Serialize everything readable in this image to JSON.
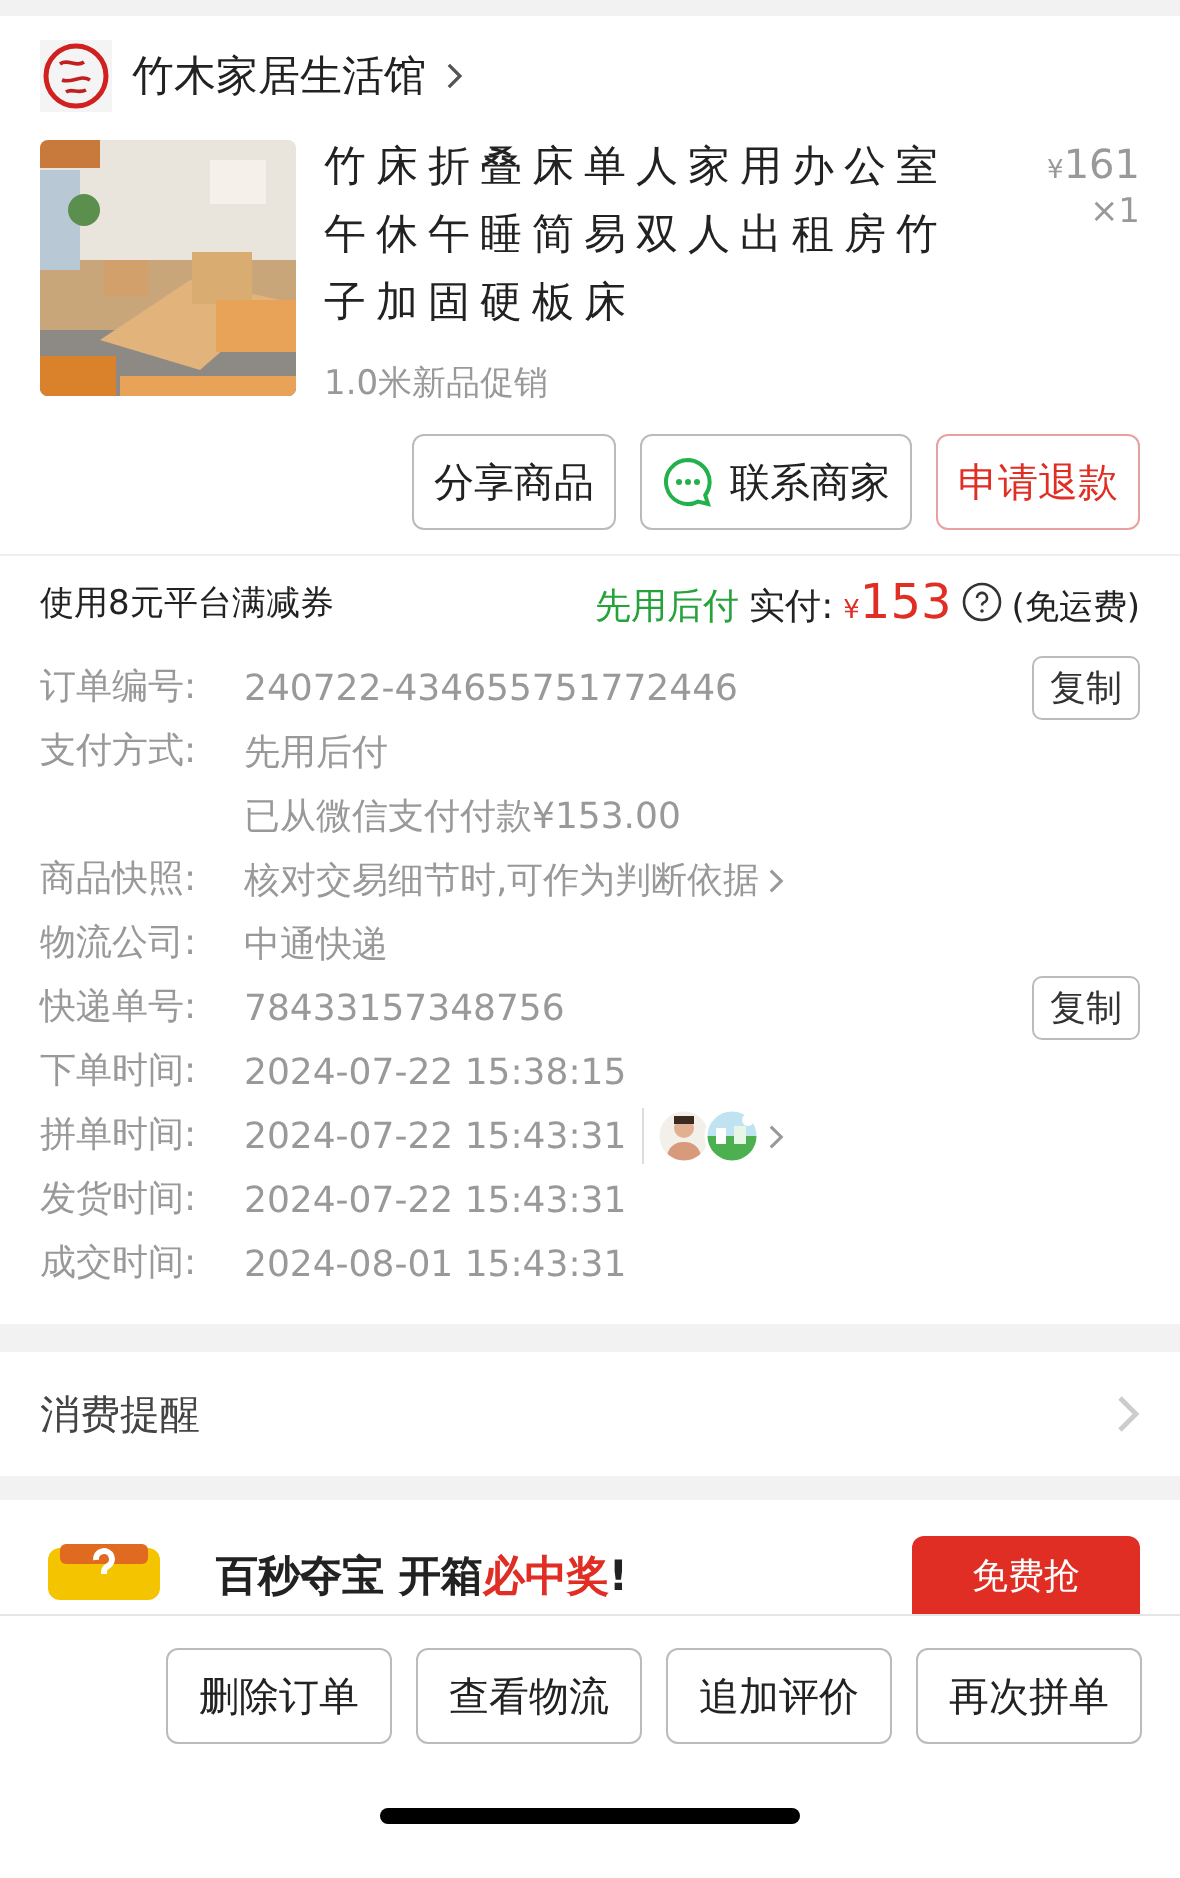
{
  "shop": {
    "name": "竹木家居生活馆"
  },
  "product": {
    "title": "竹床折叠床单人家用办公室午休午睡简易双人出租房竹子加固硬板床",
    "spec": "1.0米新品促销",
    "currency": "¥",
    "price": "161",
    "quantity": "×1"
  },
  "product_actions": [
    {
      "label": "分享商品",
      "kind": "plain"
    },
    {
      "label": "联系商家",
      "kind": "chat"
    },
    {
      "label": "申请退款",
      "kind": "danger"
    }
  ],
  "summary": {
    "coupon": "使用8元平台满减券",
    "pay_later": "先用后付",
    "paid_label": "实付:",
    "currency": "¥",
    "amount": "153",
    "shipping": "(免运费)"
  },
  "details": [
    {
      "label": "订单编号:",
      "values": [
        "240722-434655751772446"
      ],
      "action": "复制",
      "link": false
    },
    {
      "label": "支付方式:",
      "values": [
        "先用后付",
        "已从微信支付付款¥153.00"
      ],
      "link": false
    },
    {
      "label": "商品快照:",
      "values": [
        "核对交易细节时,可作为判断依据"
      ],
      "link": true
    },
    {
      "label": "物流公司:",
      "values": [
        "中通快递"
      ],
      "link": false
    },
    {
      "label": "快递单号:",
      "values": [
        "78433157348756"
      ],
      "action": "复制",
      "link": false
    },
    {
      "label": "下单时间:",
      "values": [
        "2024-07-22 15:38:15"
      ],
      "link": false
    },
    {
      "label": "拼单时间:",
      "values": [
        "2024-07-22 15:43:31"
      ],
      "avatars": [
        {
          "kind": "picture"
        },
        {
          "kind": "picture"
        }
      ],
      "link": true
    },
    {
      "label": "发货时间:",
      "values": [
        "2024-07-22 15:43:31"
      ],
      "link": false
    },
    {
      "label": "成交时间:",
      "values": [
        "2024-08-01 15:43:31"
      ],
      "link": false
    }
  ],
  "reminder": {
    "label": "消费提醒"
  },
  "promo": {
    "text": "百秒夺宝 开箱",
    "highlight": "必中奖",
    "tail": "!",
    "button": "免费抢"
  },
  "bottom_actions": [
    "删除订单",
    "查看物流",
    "追加评价",
    "再次拼单"
  ]
}
